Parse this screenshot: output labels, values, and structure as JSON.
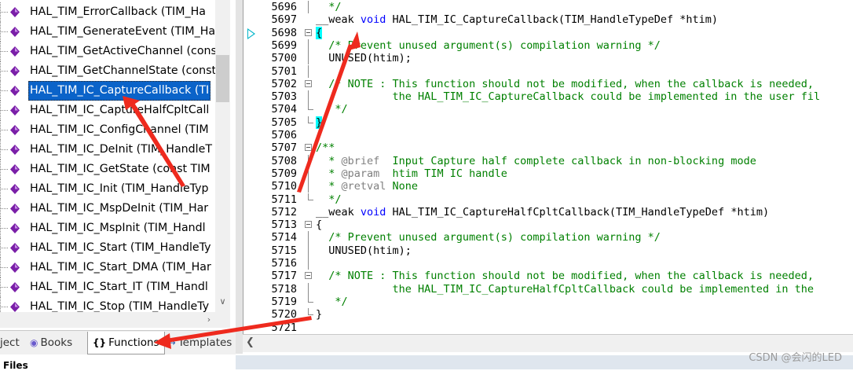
{
  "functions_panel": {
    "items": [
      {
        "label": "HAL_TIM_ErrorCallback (TIM_Ha",
        "selected": false
      },
      {
        "label": "HAL_TIM_GenerateEvent (TIM_Ha",
        "selected": false
      },
      {
        "label": "HAL_TIM_GetActiveChannel (cons",
        "selected": false
      },
      {
        "label": "HAL_TIM_GetChannelState (const",
        "selected": false
      },
      {
        "label": "HAL_TIM_IC_CaptureCallback (TI",
        "selected": true
      },
      {
        "label": "HAL_TIM_IC_CaptureHalfCpltCall",
        "selected": false
      },
      {
        "label": "HAL_TIM_IC_ConfigChannel (TIM",
        "selected": false
      },
      {
        "label": "HAL_TIM_IC_DeInit (TIM_HandleT",
        "selected": false
      },
      {
        "label": "HAL_TIM_IC_GetState (const TIM",
        "selected": false
      },
      {
        "label": "HAL_TIM_IC_Init (TIM_HandleTyp",
        "selected": false
      },
      {
        "label": "HAL_TIM_IC_MspDeInit (TIM_Har",
        "selected": false
      },
      {
        "label": "HAL_TIM_IC_MspInit (TIM_Handl",
        "selected": false
      },
      {
        "label": "HAL_TIM_IC_Start (TIM_HandleTy",
        "selected": false
      },
      {
        "label": "HAL_TIM_IC_Start_DMA (TIM_Har",
        "selected": false
      },
      {
        "label": "HAL_TIM_IC_Start_IT (TIM_Handl",
        "selected": false
      },
      {
        "label": "HAL_TIM_IC_Stop (TIM_HandleTy",
        "selected": false
      }
    ]
  },
  "tabs": {
    "project": "ject",
    "books": "Books",
    "functions": "Functions",
    "templates": "Templates"
  },
  "status": {
    "files": "Files",
    "watermark": "CSDN @会闪的LED"
  },
  "editor": {
    "lines": [
      {
        "num": "5696",
        "text": "  */",
        "kind": "comment",
        "fold": "line"
      },
      {
        "num": "5697",
        "text": "__weak void HAL_TIM_IC_CaptureCallback(TIM_HandleTypeDef *htim)",
        "kind": "decl",
        "fold": "none"
      },
      {
        "num": "5698",
        "text": "{",
        "kind": "brace-open-hl",
        "fold": "open"
      },
      {
        "num": "5699",
        "text": "  /* Prevent unused argument(s) compilation warning */",
        "kind": "comment",
        "fold": "line"
      },
      {
        "num": "5700",
        "text": "  UNUSED(htim);",
        "kind": "code",
        "fold": "line"
      },
      {
        "num": "5701",
        "text": "",
        "kind": "code",
        "fold": "line"
      },
      {
        "num": "5702",
        "text": "  /* NOTE : This function should not be modified, when the callback is needed,",
        "kind": "comment",
        "fold": "open"
      },
      {
        "num": "5703",
        "text": "            the HAL_TIM_IC_CaptureCallback could be implemented in the user fil",
        "kind": "comment",
        "fold": "line"
      },
      {
        "num": "5704",
        "text": "   */",
        "kind": "comment",
        "fold": "end"
      },
      {
        "num": "5705",
        "text": "}",
        "kind": "brace-close-hl",
        "fold": "end"
      },
      {
        "num": "5706",
        "text": "",
        "kind": "code",
        "fold": "none"
      },
      {
        "num": "5707",
        "text": "/**",
        "kind": "comment",
        "fold": "open"
      },
      {
        "num": "5708",
        "text": "  * @brief  Input Capture half complete callback in non-blocking mode",
        "kind": "doc",
        "fold": "line"
      },
      {
        "num": "5709",
        "text": "  * @param  htim TIM IC handle",
        "kind": "doc",
        "fold": "line"
      },
      {
        "num": "5710",
        "text": "  * @retval None",
        "kind": "doc",
        "fold": "line"
      },
      {
        "num": "5711",
        "text": "  */",
        "kind": "comment",
        "fold": "end"
      },
      {
        "num": "5712",
        "text": "__weak void HAL_TIM_IC_CaptureHalfCpltCallback(TIM_HandleTypeDef *htim)",
        "kind": "decl",
        "fold": "none"
      },
      {
        "num": "5713",
        "text": "{",
        "kind": "code",
        "fold": "open"
      },
      {
        "num": "5714",
        "text": "  /* Prevent unused argument(s) compilation warning */",
        "kind": "comment",
        "fold": "line"
      },
      {
        "num": "5715",
        "text": "  UNUSED(htim);",
        "kind": "code",
        "fold": "line"
      },
      {
        "num": "5716",
        "text": "",
        "kind": "code",
        "fold": "line"
      },
      {
        "num": "5717",
        "text": "  /* NOTE : This function should not be modified, when the callback is needed,",
        "kind": "comment",
        "fold": "open"
      },
      {
        "num": "5718",
        "text": "            the HAL_TIM_IC_CaptureHalfCpltCallback could be implemented in the",
        "kind": "comment",
        "fold": "line"
      },
      {
        "num": "5719",
        "text": "   */",
        "kind": "comment",
        "fold": "end"
      },
      {
        "num": "5720",
        "text": "}",
        "kind": "code",
        "fold": "end"
      },
      {
        "num": "5721",
        "text": "",
        "kind": "code",
        "fold": "none"
      }
    ]
  },
  "colors": {
    "selection": "#0a63c9",
    "keyword": "#0000ff",
    "comment": "#008000",
    "annotation_arrow": "#ee2a1e",
    "brace_highlight": "#00ffff",
    "current_line_marker": "#00b4c8"
  }
}
